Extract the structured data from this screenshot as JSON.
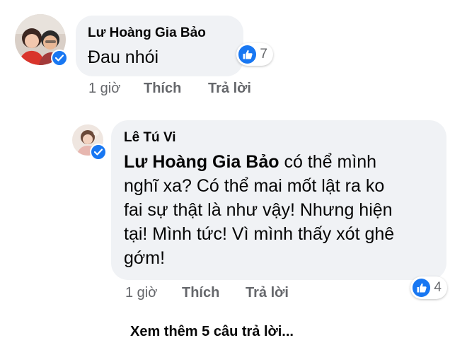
{
  "comments": [
    {
      "author": "Lư Hoàng Gia Bảo",
      "text": "Đau nhói",
      "time": "1 giờ",
      "like_label": "Thích",
      "reply_label": "Trả lời",
      "reaction_icon": "thumbs-up-icon",
      "reaction_count": "7",
      "verified_icon": "check-badge-icon"
    },
    {
      "author": "Lê Tú Vi",
      "mention": "Lư Hoàng Gia Bảo",
      "text_line1": " có thể mình",
      "text_line2": "nghĩ xa? Có thể mai mốt lật ra ko",
      "text_line3": "fai sự thật là như vậy! Nhưng hiện",
      "text_line4": "tại! Mình tức! Vì mình thấy xót ghê",
      "text_line5": "gớm!",
      "time": "1 giờ",
      "like_label": "Thích",
      "reply_label": "Trả lời",
      "reaction_icon": "thumbs-up-icon",
      "reaction_count": "4",
      "verified_icon": "check-badge-icon"
    }
  ],
  "view_more_label": "Xem thêm 5 câu trả lời...",
  "colors": {
    "bubble": "#f0f2f5",
    "text": "#050505",
    "meta": "#65676b",
    "accent": "#1877f2"
  }
}
